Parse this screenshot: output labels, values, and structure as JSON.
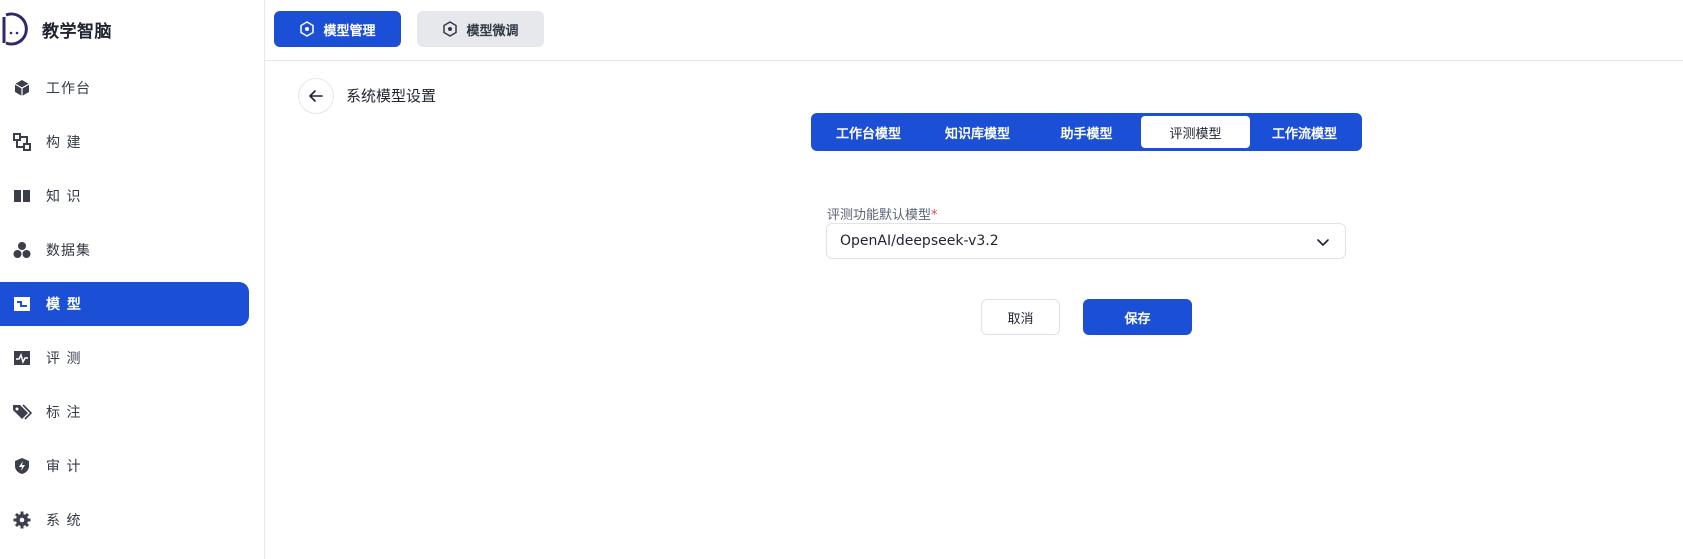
{
  "brand": {
    "name": "教学智脑",
    "logo_icon": "brand-logo-icon"
  },
  "sidebar": {
    "items": [
      {
        "label": "工作台",
        "icon": "cube-icon",
        "active": false
      },
      {
        "label": "构 建",
        "icon": "build-icon",
        "active": false
      },
      {
        "label": "知 识",
        "icon": "book-icon",
        "active": false
      },
      {
        "label": "数据集",
        "icon": "dataset-icon",
        "active": false
      },
      {
        "label": "模 型",
        "icon": "model-icon",
        "active": true
      },
      {
        "label": "评 测",
        "icon": "activity-icon",
        "active": false
      },
      {
        "label": "标 注",
        "icon": "tag-icon",
        "active": false
      },
      {
        "label": "审 计",
        "icon": "shield-bolt-icon",
        "active": false
      },
      {
        "label": "系 统",
        "icon": "gear-icon",
        "active": false
      }
    ]
  },
  "topbar": {
    "tabs": [
      {
        "label": "模型管理",
        "icon": "hexagon-icon",
        "active": true
      },
      {
        "label": "模型微调",
        "icon": "hexagon-icon",
        "active": false
      }
    ]
  },
  "main": {
    "title": "系统模型设置",
    "segments": [
      {
        "label": "工作台模型",
        "active": false
      },
      {
        "label": "知识库模型",
        "active": false
      },
      {
        "label": "助手模型",
        "active": false
      },
      {
        "label": "评测模型",
        "active": true
      },
      {
        "label": "工作流模型",
        "active": false
      }
    ],
    "field": {
      "label": "评测功能默认模型",
      "required_mark": "*",
      "value": "OpenAI/deepseek-v3.2"
    },
    "cancel_label": "取消",
    "save_label": "保存"
  },
  "colors": {
    "accent": "#1b4fd6",
    "required": "#e5484d"
  }
}
